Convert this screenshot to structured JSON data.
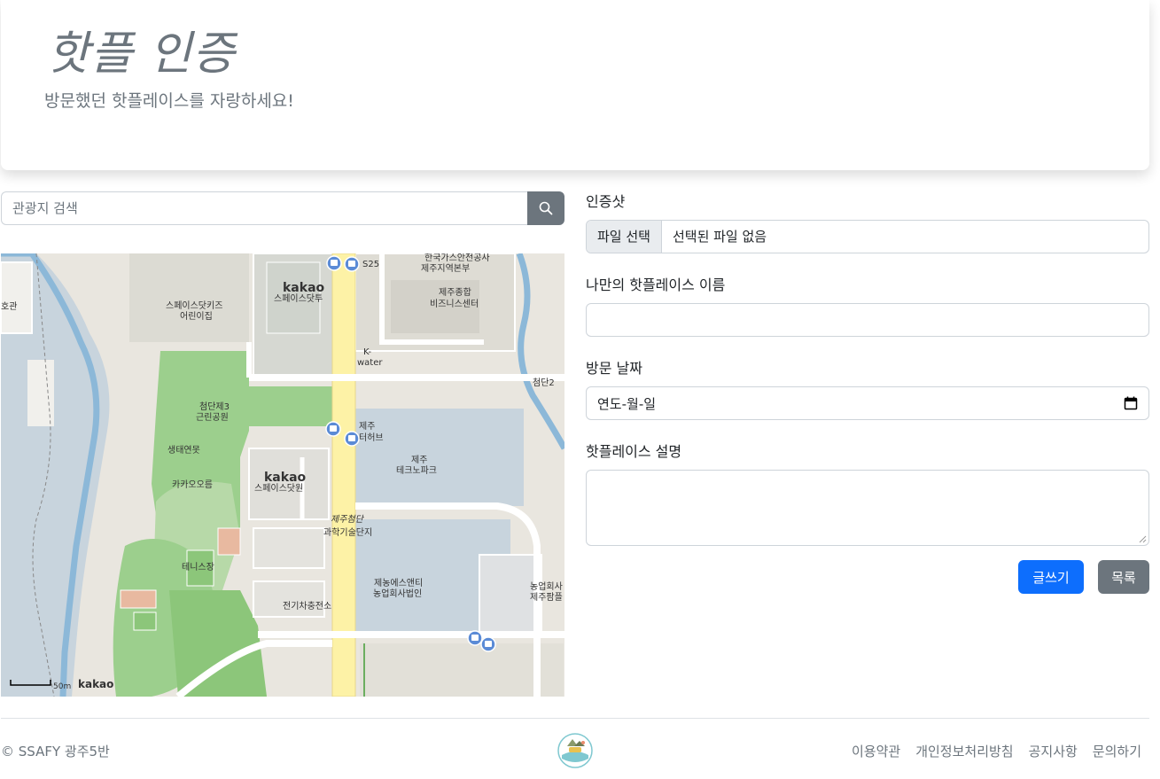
{
  "hero": {
    "title": "핫플 인증",
    "subtitle": "방문했던 핫플레이스를 자랑하세요!"
  },
  "search": {
    "placeholder": "관광지 검색",
    "button_icon": "search-icon"
  },
  "map": {
    "provider": "kakao",
    "scale_label": "50m",
    "labels": {
      "kakao_dot_two": "스페이스닷투",
      "kids": "스페이스닷키즈",
      "kids2": "어린이집",
      "gas": "한국가스안전공사",
      "gas2": "제주지역본부",
      "biz": "제주종합",
      "biz2": "비즈니스센터",
      "kwater": "K-",
      "kwater2": "water",
      "park": "첨단제3",
      "park2": "근린공원",
      "eco": "생태연못",
      "kaka": "카카오오름",
      "dot_one": "스페이스닷원",
      "tech": "제주",
      "tech2": "테크노파크",
      "hub": "제주",
      "hub2": "터허브",
      "cheomdan": "제주첨단",
      "cheomdan2": "과학기술단지",
      "tennis": "테니스장",
      "charge": "전기차충전소",
      "nong": "제농에스앤티",
      "nong2": "농업회사법인",
      "nong3": "농업회사",
      "nong4": "제주팜플",
      "s25": "S25",
      "kakao_logo": "kakao",
      "hogwan": "호관",
      "cheomdan_road": "첨단2"
    }
  },
  "form": {
    "photo_label": "인증샷",
    "file_button": "파일 선택",
    "file_status": "선택된 파일 없음",
    "name_label": "나만의 핫플레이스 이름",
    "name_value": "",
    "date_label": "방문 날짜",
    "date_placeholder": "연도-월-일",
    "desc_label": "핫플레이스 설명",
    "submit_label": "글쓰기",
    "list_label": "목록"
  },
  "footer": {
    "copyright": "© SSAFY 광주5반",
    "links": [
      "이용약관",
      "개인정보처리방침",
      "공지사항",
      "문의하기"
    ],
    "logo_icon": "enjoy-trip-logo-icon"
  },
  "colors": {
    "primary": "#0d6efd",
    "secondary": "#6c757d",
    "road": "#fdf2a6",
    "park": "#9ccf8d",
    "water": "#8cb8d8"
  }
}
